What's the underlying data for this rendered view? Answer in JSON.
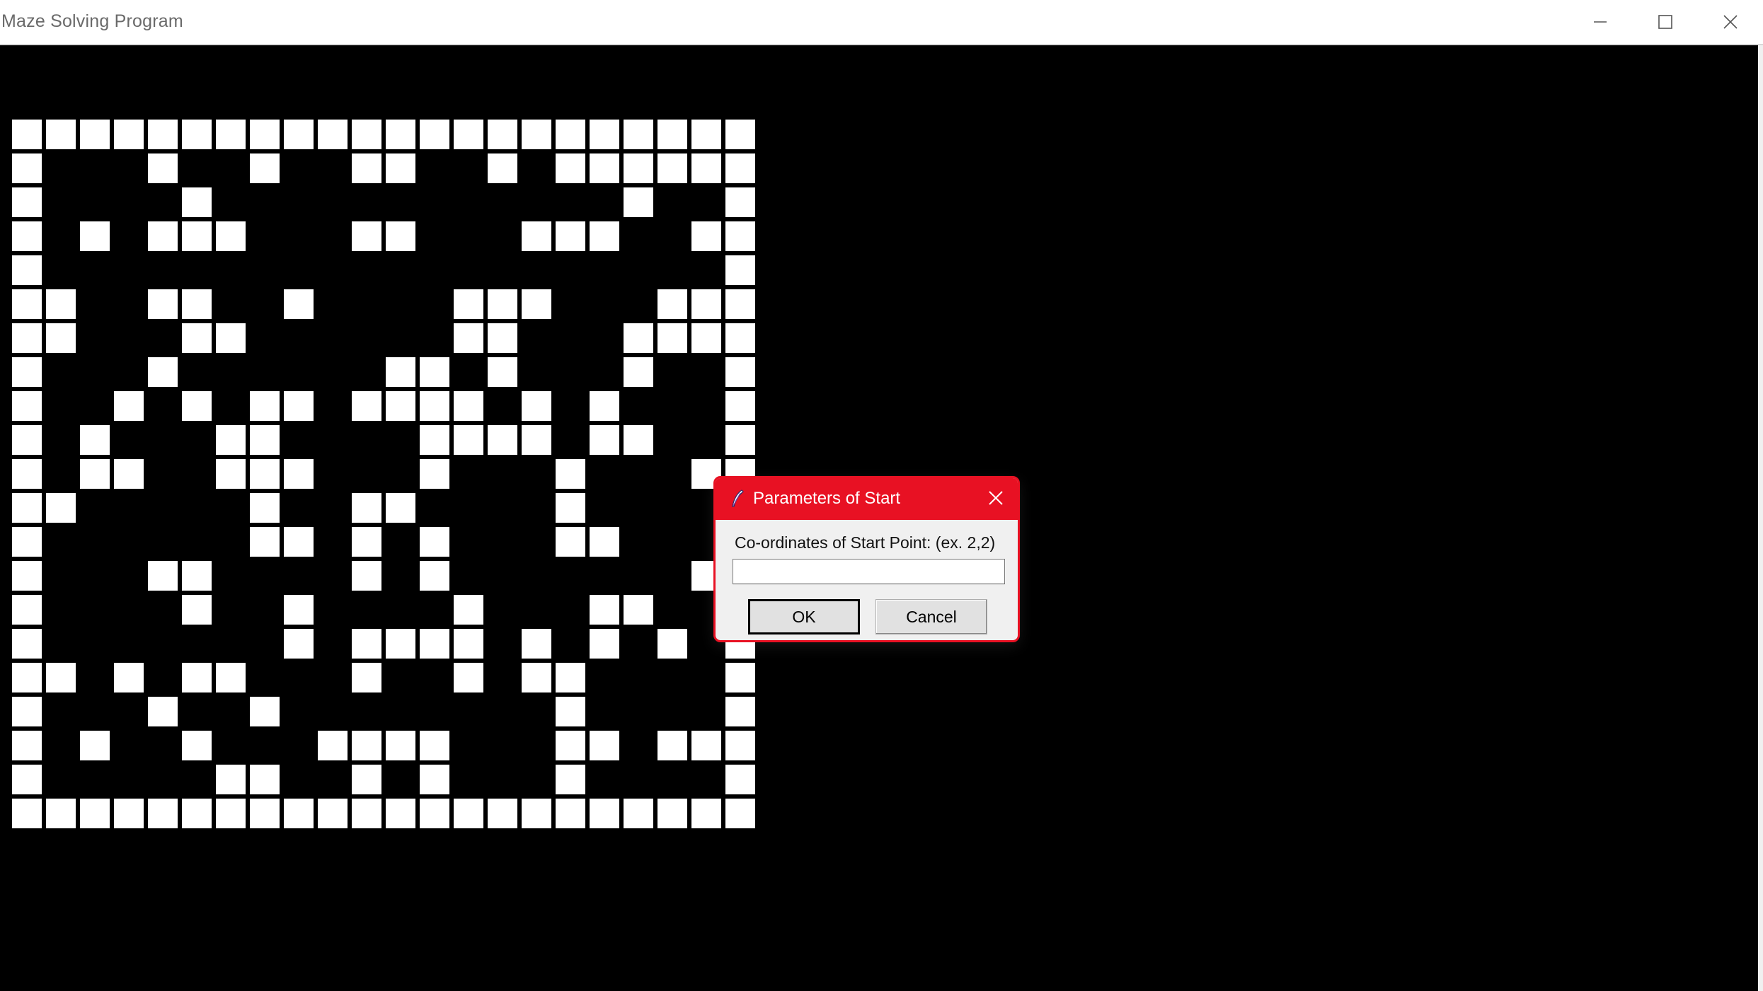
{
  "window": {
    "title": "Maze Solving Program",
    "controls": {
      "minimize": "minimize-icon",
      "maximize": "maximize-icon",
      "close": "close-icon"
    }
  },
  "maze": {
    "cols": 22,
    "rows": 21,
    "wall_color": "#ffffff",
    "floor_color": "#000000",
    "grid": [
      "1111111111111111111111",
      "1000100100110010111111",
      "1000010000000000001001",
      "1010111000110001110011",
      "1000000000000000000001",
      "1100110010000111000111",
      "1100011000000110001111",
      "1000100000011010001001",
      "1001010110111101010001",
      "1010001100001111011001",
      "1011001110001000100011",
      "1100000100110000100000",
      "1000000110101000110000",
      "1000110000101000000010",
      "1000010010000100011000",
      "1000000010111101010101",
      "1101011000100101100001",
      "1000100100000000100001",
      "1010010001111000110111",
      "1000001100101000100001",
      "1111111111111111111111"
    ]
  },
  "dialog": {
    "title": "Parameters of Start",
    "prompt": "Co-ordinates of Start Point: (ex. 2,2)",
    "input_value": "",
    "ok_label": "OK",
    "cancel_label": "Cancel",
    "accent_color": "#e81123",
    "icon": "feather-icon",
    "close_icon": "close-icon"
  }
}
